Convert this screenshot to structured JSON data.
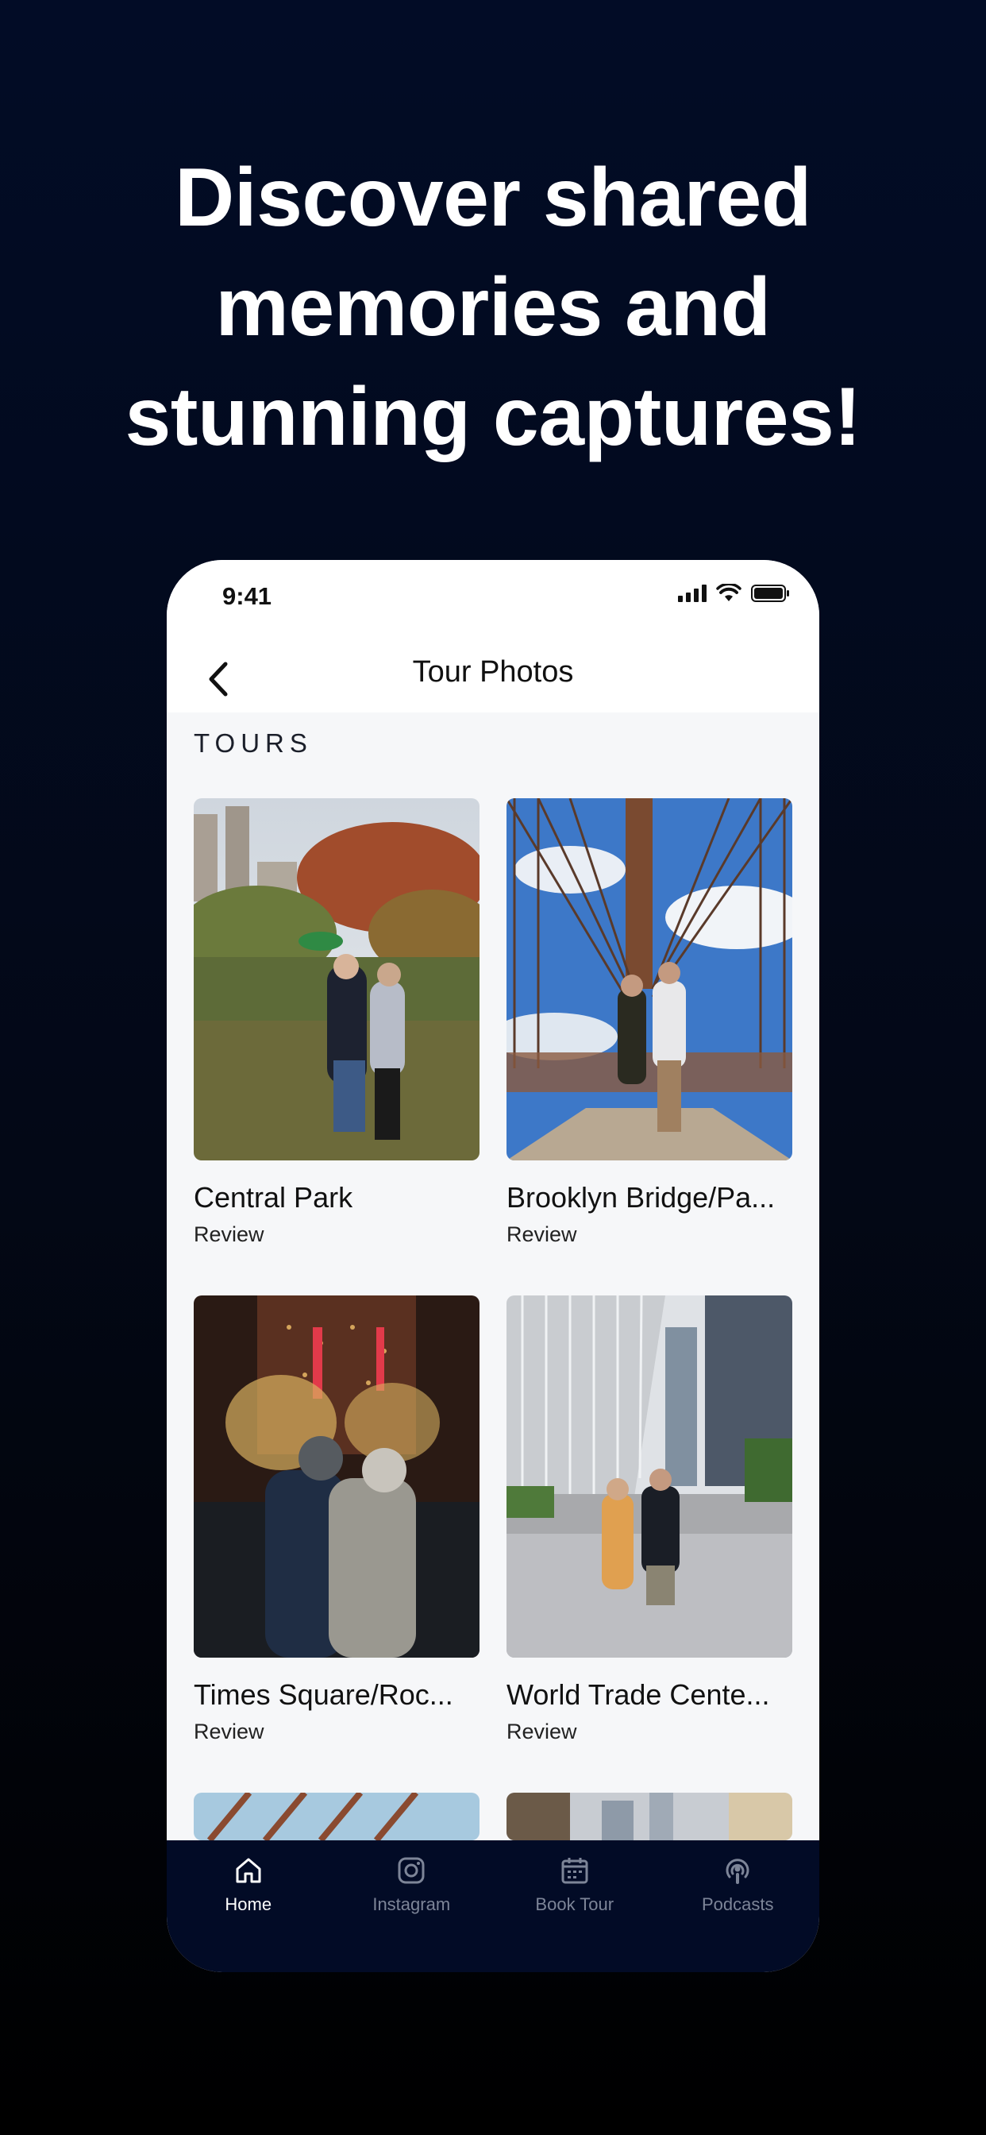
{
  "headline": {
    "line1": "Discover shared",
    "line2": "memories and",
    "line3": "stunning captures!"
  },
  "status_bar": {
    "time": "9:41"
  },
  "nav": {
    "title": "Tour Photos",
    "back_icon": "chevron-left-icon"
  },
  "section": {
    "label": "TOURS"
  },
  "tours": [
    {
      "title": "Central Park",
      "subtitle": "Review"
    },
    {
      "title": "Brooklyn Bridge/Pa...",
      "subtitle": "Review"
    },
    {
      "title": "Times Square/Roc...",
      "subtitle": "Review"
    },
    {
      "title": "World Trade Cente...",
      "subtitle": "Review"
    }
  ],
  "tabbar": {
    "items": [
      {
        "label": "Home",
        "icon": "home-icon",
        "active": true
      },
      {
        "label": "Instagram",
        "icon": "instagram-icon",
        "active": false
      },
      {
        "label": "Book Tour",
        "icon": "calendar-icon",
        "active": false
      },
      {
        "label": "Podcasts",
        "icon": "podcast-icon",
        "active": false
      }
    ]
  },
  "colors": {
    "background": "#020c26",
    "tabbar": "#020b26",
    "active_tab": "#ffffff",
    "inactive_tab": "#7d8598"
  }
}
